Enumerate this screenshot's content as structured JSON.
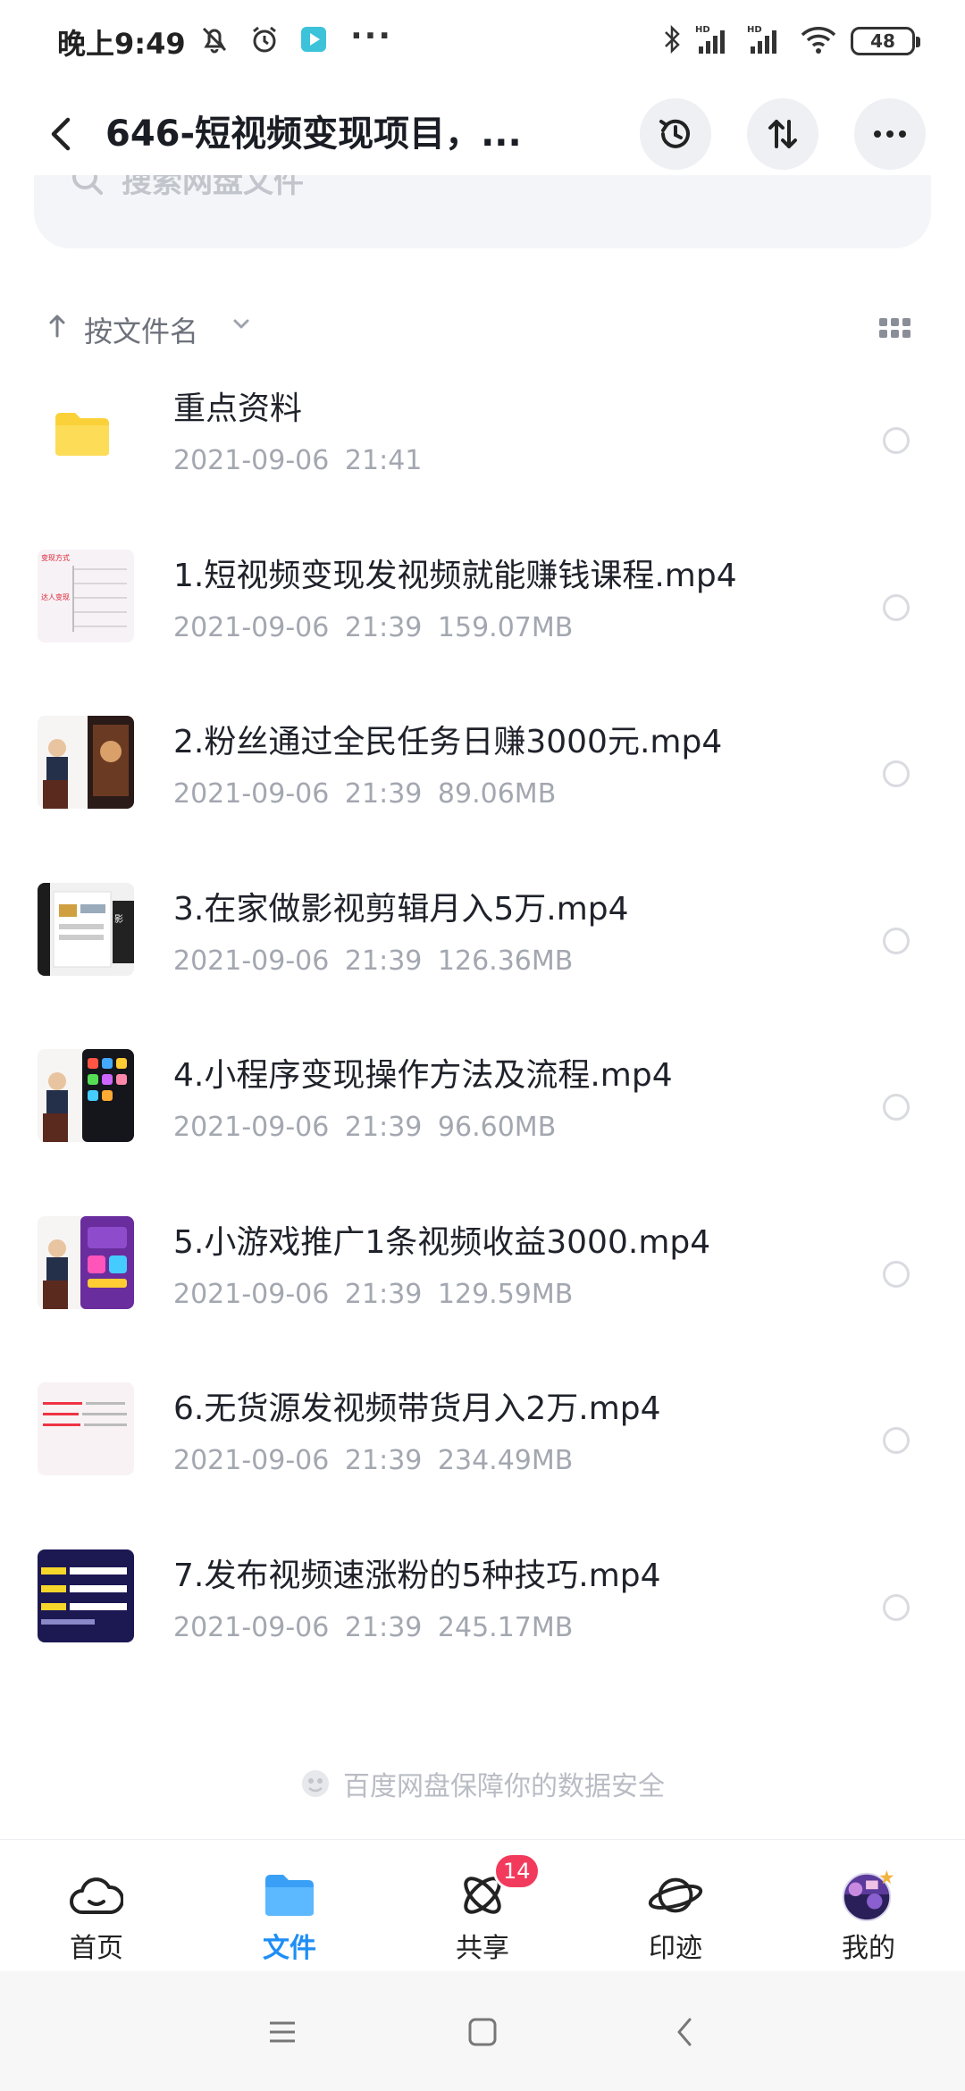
{
  "status_bar": {
    "time": "晚上9:49",
    "more": "···",
    "battery": "48"
  },
  "header": {
    "title": "646-短视频变现项目，...",
    "buttons": [
      "history-icon",
      "transfer-icon",
      "more-icon"
    ]
  },
  "search": {
    "placeholder": "搜索网盘文件"
  },
  "sort": {
    "label": "按文件名"
  },
  "files": [
    {
      "name": "重点资料",
      "date": "2021-09-06",
      "time": "21:41",
      "size": "",
      "type": "folder"
    },
    {
      "name": "1.短视频变现发视频就能赚钱课程.mp4",
      "date": "2021-09-06",
      "time": "21:39",
      "size": "159.07MB",
      "type": "video"
    },
    {
      "name": "2.粉丝通过全民任务日赚3000元.mp4",
      "date": "2021-09-06",
      "time": "21:39",
      "size": "89.06MB",
      "type": "video"
    },
    {
      "name": "3.在家做影视剪辑月入5万.mp4",
      "date": "2021-09-06",
      "time": "21:39",
      "size": "126.36MB",
      "type": "video"
    },
    {
      "name": "4.小程序变现操作方法及流程.mp4",
      "date": "2021-09-06",
      "time": "21:39",
      "size": "96.60MB",
      "type": "video"
    },
    {
      "name": "5.小游戏推广1条视频收益3000.mp4",
      "date": "2021-09-06",
      "time": "21:39",
      "size": "129.59MB",
      "type": "video"
    },
    {
      "name": "6.无货源发视频带货月入2万.mp4",
      "date": "2021-09-06",
      "time": "21:39",
      "size": "234.49MB",
      "type": "video"
    },
    {
      "name": "7.发布视频速涨粉的5种技巧.mp4",
      "date": "2021-09-06",
      "time": "21:39",
      "size": "245.17MB",
      "type": "video"
    }
  ],
  "footnote": "百度网盘保障你的数据安全",
  "bottom_nav": {
    "items": [
      {
        "label": "首页",
        "icon": "home-cloud-icon",
        "active": false
      },
      {
        "label": "文件",
        "icon": "folder-icon",
        "active": true
      },
      {
        "label": "共享",
        "icon": "share-atom-icon",
        "active": false,
        "badge": "14"
      },
      {
        "label": "印迹",
        "icon": "planet-icon",
        "active": false
      },
      {
        "label": "我的",
        "icon": "avatar",
        "active": false
      }
    ]
  },
  "colors": {
    "accent": "#1e8ef5",
    "folder": "#fbd13a",
    "badge": "#f23b5c"
  }
}
